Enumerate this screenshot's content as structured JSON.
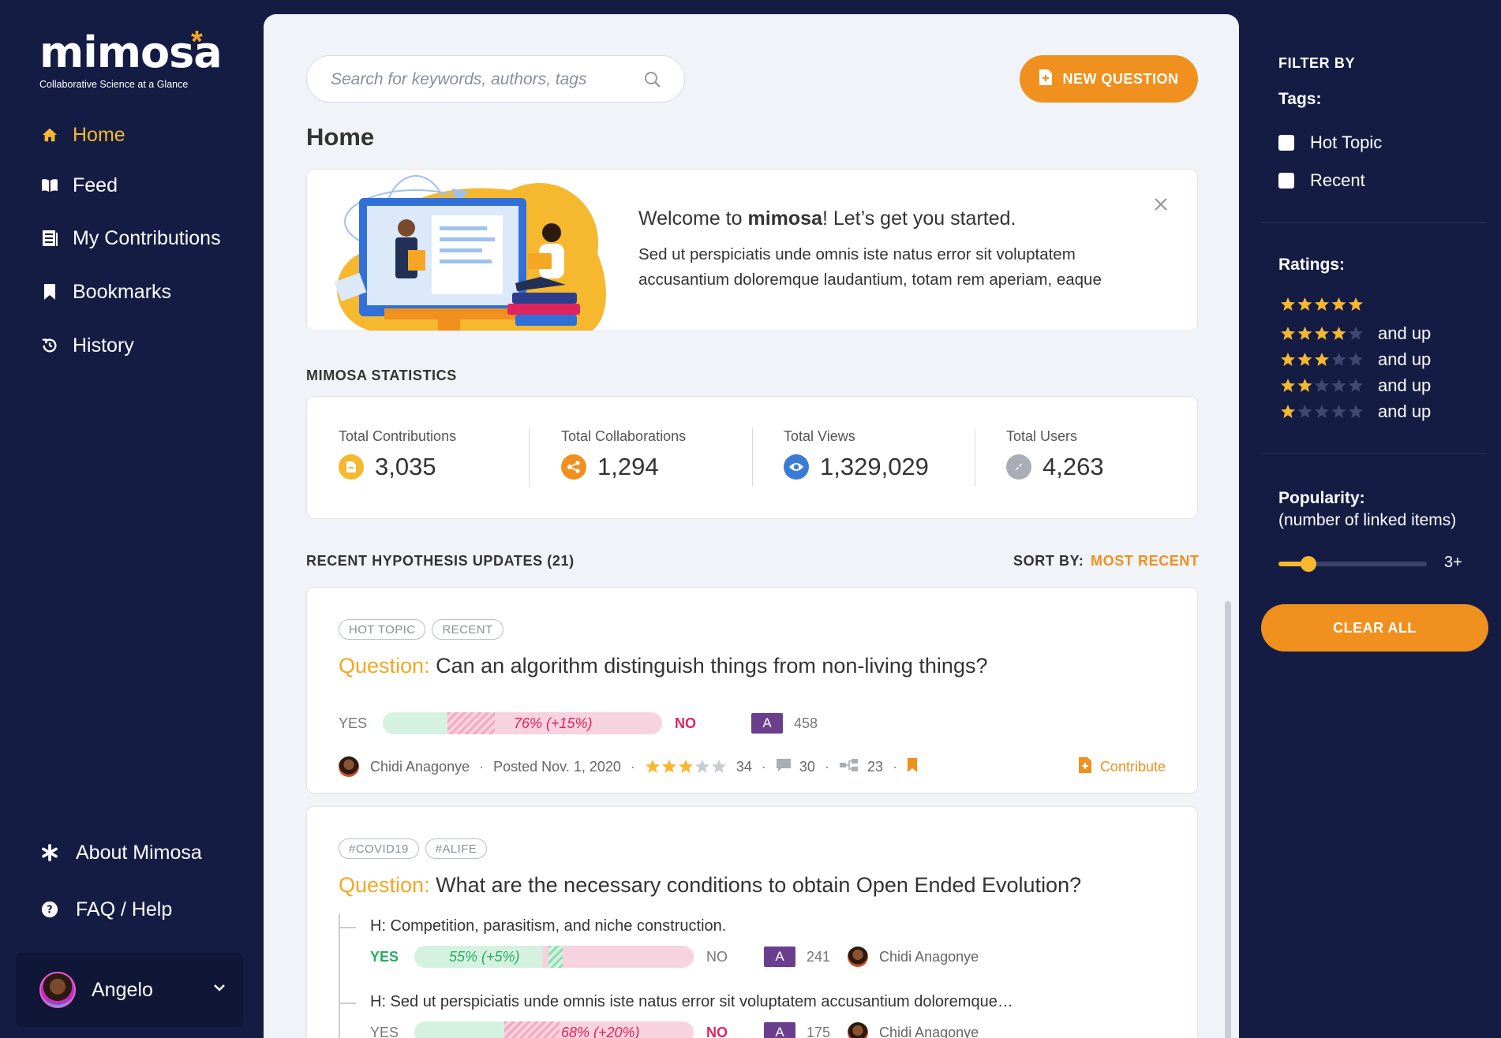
{
  "app": {
    "logo_text": "mimosa",
    "tagline": "Collaborative Science at a Glance"
  },
  "sidebar": {
    "items": [
      {
        "label": "Home",
        "icon": "home-icon",
        "active": true
      },
      {
        "label": "Feed",
        "icon": "book-open-icon"
      },
      {
        "label": "My Contributions",
        "icon": "list-icon"
      },
      {
        "label": "Bookmarks",
        "icon": "bookmark-icon"
      },
      {
        "label": "History",
        "icon": "history-icon"
      }
    ],
    "bottom_items": [
      {
        "label": "About Mimosa",
        "icon": "asterisk-icon"
      },
      {
        "label": "FAQ / Help",
        "icon": "help-icon"
      }
    ],
    "user": {
      "name": "Angelo"
    }
  },
  "header": {
    "search_placeholder": "Search for keywords, authors, tags",
    "new_question_label": "NEW QUESTION"
  },
  "page_title": "Home",
  "welcome": {
    "title_prefix": "Welcome to ",
    "title_brand": "mimosa",
    "title_suffix": "! Let’s get you started.",
    "body": "Sed ut perspiciatis unde omnis iste natus error sit voluptatem accusantium doloremque laudantium, totam rem aperiam, eaque"
  },
  "stats": {
    "section_label": "MIMOSA STATISTICS",
    "items": [
      {
        "label": "Total Contributions",
        "value": "3,035",
        "icon": "document-icon",
        "color": "#f5b82e"
      },
      {
        "label": "Total Collaborations",
        "value": "1,294",
        "icon": "share-icon",
        "color": "#f0901e"
      },
      {
        "label": "Total Views",
        "value": "1,329,029",
        "icon": "eye-icon",
        "color": "#3a7bd5"
      },
      {
        "label": "Total Users",
        "value": "4,263",
        "icon": "compass-icon",
        "color": "#a9adb5"
      }
    ]
  },
  "updates": {
    "section_label": "RECENT HYPOTHESIS UPDATES (21)",
    "sort_label": "SORT BY:",
    "sort_value": "MOST RECENT",
    "cards": [
      {
        "tags": [
          "HOT TOPIC",
          "RECENT"
        ],
        "question_prefix": "Question:",
        "question": "Can an algorithm distinguish things from non-living things?",
        "yes_label": "YES",
        "no_label": "NO",
        "bar_text": "76% (+15%)",
        "no_share": 0.76,
        "answer_badge": "A",
        "answer_count": "458",
        "author": "Chidi Anagonye",
        "posted": "Posted Nov. 1, 2020",
        "rating": 3,
        "rating_count": "34",
        "comments": "30",
        "links": "23",
        "contribute_label": "Contribute"
      },
      {
        "tags": [
          "#COVID19",
          "#ALIFE"
        ],
        "question_prefix": "Question:",
        "question": "What are the necessary conditions to obtain Open Ended Evolution?",
        "hypotheses": [
          {
            "text": "H: Competition, parasitism, and niche construction.",
            "yes_label": "YES",
            "no_label": "NO",
            "bar_text": "55% (+5%)",
            "yes_share": 0.55,
            "answer_badge": "A",
            "answer_count": "241",
            "author": "Chidi Anagonye"
          },
          {
            "text": "H: Sed ut perspiciatis unde omnis iste natus error sit voluptatem accusantium doloremque…",
            "yes_label": "YES",
            "no_label": "NO",
            "bar_text": "68% (+20%)",
            "no_share": 0.68,
            "answer_badge": "A",
            "answer_count": "175",
            "author": "Chidi Anagonye"
          }
        ]
      }
    ]
  },
  "filters": {
    "heading": "FILTER BY",
    "tags_label": "Tags:",
    "tags": [
      "Hot Topic",
      "Recent"
    ],
    "ratings_label": "Ratings:",
    "ratings": [
      {
        "stars": 5,
        "suffix": ""
      },
      {
        "stars": 4,
        "suffix": "and up"
      },
      {
        "stars": 3,
        "suffix": "and up"
      },
      {
        "stars": 2,
        "suffix": "and up"
      },
      {
        "stars": 1,
        "suffix": "and up"
      }
    ],
    "popularity_label": "Popularity:",
    "popularity_sub": "(number of linked items)",
    "popularity_value": "3+",
    "popularity_level": 0.2,
    "clear_label": "CLEAR ALL"
  },
  "colors": {
    "navy": "#141c44",
    "accent_orange": "#f0901e",
    "accent_yellow": "#f5b82e",
    "yes_green": "#27ae60",
    "no_pink": "#e0245e"
  }
}
